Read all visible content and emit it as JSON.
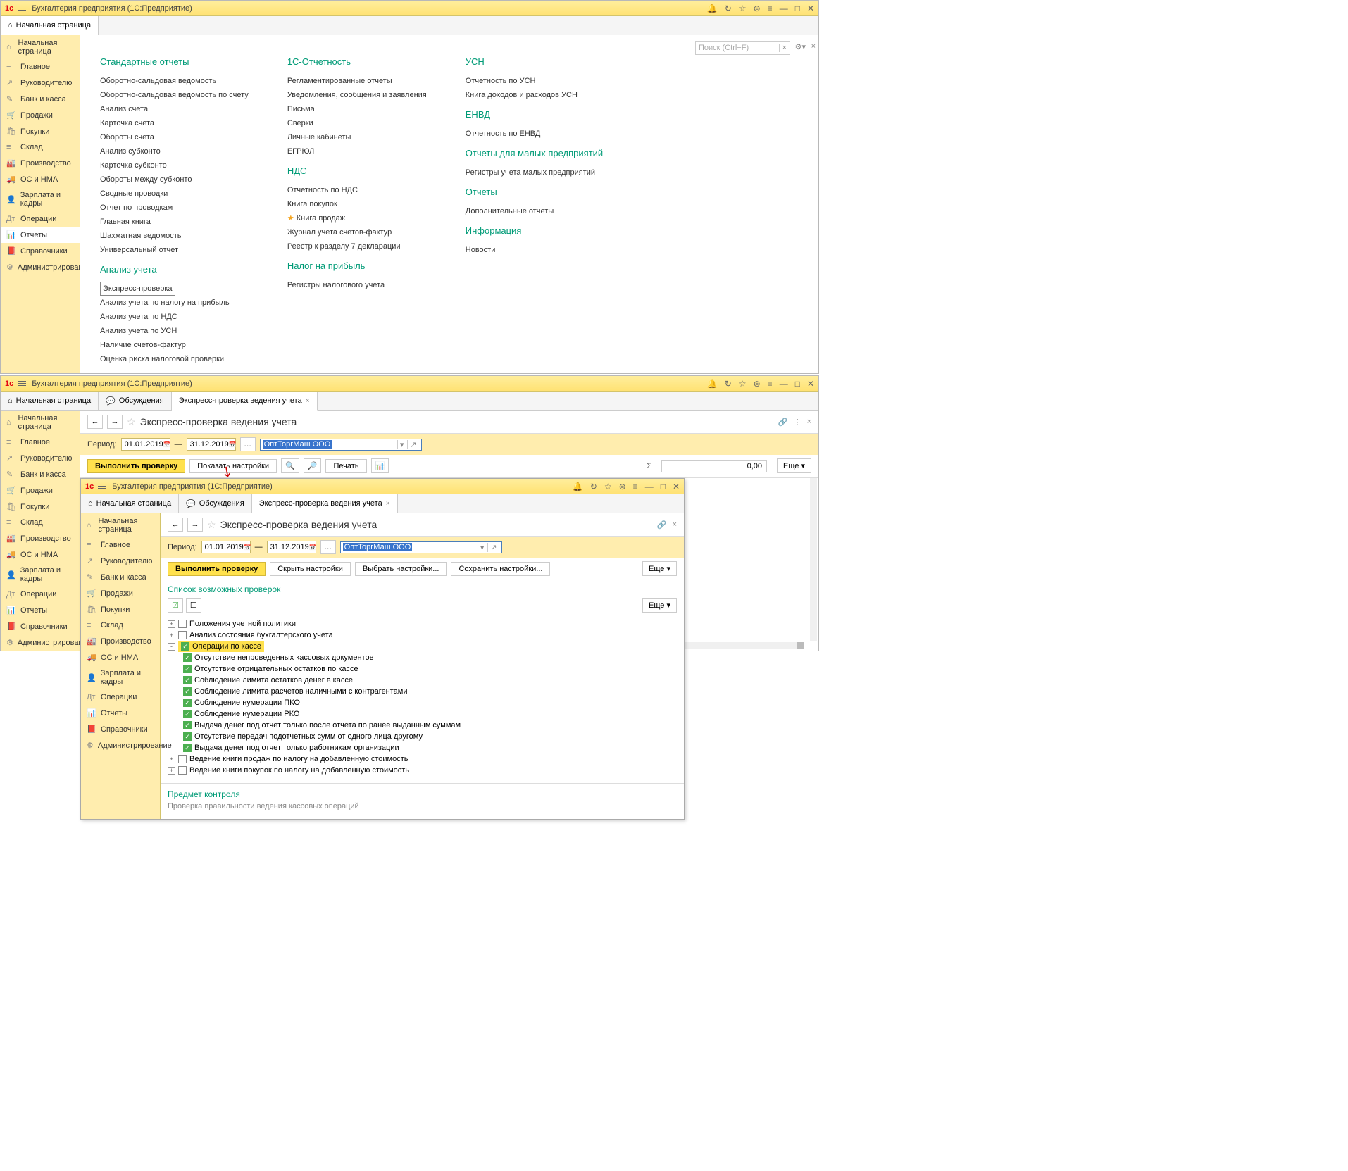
{
  "titlebar": {
    "app": "Бухгалтерия предприятия",
    "platform": "(1С:Предприятие)"
  },
  "search_placeholder": "Поиск (Ctrl+F)",
  "sidebar": [
    {
      "icon": "⌂",
      "label": "Начальная страница"
    },
    {
      "icon": "≡",
      "label": "Главное"
    },
    {
      "icon": "↗",
      "label": "Руководителю"
    },
    {
      "icon": "✎",
      "label": "Банк и касса"
    },
    {
      "icon": "🛒",
      "label": "Продажи"
    },
    {
      "icon": "🛍",
      "label": "Покупки"
    },
    {
      "icon": "≡",
      "label": "Склад"
    },
    {
      "icon": "🏭",
      "label": "Производство"
    },
    {
      "icon": "🚚",
      "label": "ОС и НМА"
    },
    {
      "icon": "👤",
      "label": "Зарплата и кадры"
    },
    {
      "icon": "Дт",
      "label": "Операции"
    },
    {
      "icon": "📊",
      "label": "Отчеты"
    },
    {
      "icon": "📕",
      "label": "Справочники"
    },
    {
      "icon": "⚙",
      "label": "Администрирование"
    }
  ],
  "reports": {
    "col1": {
      "h1": "Стандартные отчеты",
      "links1": [
        "Оборотно-сальдовая ведомость",
        "Оборотно-сальдовая ведомость по счету",
        "Анализ счета",
        "Карточка счета",
        "Обороты счета",
        "Анализ субконто",
        "Карточка субконто",
        "Обороты между субконто",
        "Сводные проводки",
        "Отчет по проводкам",
        "Главная книга",
        "Шахматная ведомость",
        "Универсальный отчет"
      ],
      "h2": "Анализ учета",
      "links2_boxed": "Экспресс-проверка",
      "links2": [
        "Анализ учета по налогу на прибыль",
        "Анализ учета по НДС",
        "Анализ учета по УСН",
        "Наличие счетов-фактур",
        "Оценка риска налоговой проверки"
      ]
    },
    "col2": {
      "h1": "1С-Отчетность",
      "links1": [
        "Регламентированные отчеты",
        "Уведомления, сообщения и заявления",
        "Письма",
        "Сверки",
        "Личные кабинеты",
        "ЕГРЮЛ"
      ],
      "h2": "НДС",
      "links2": [
        "Отчетность по НДС",
        "Книга покупок"
      ],
      "links2_star": "Книга продаж",
      "links2b": [
        "Журнал учета счетов-фактур",
        "Реестр к разделу 7 декларации"
      ],
      "h3": "Налог на прибыль",
      "links3": [
        "Регистры налогового учета"
      ]
    },
    "col3": {
      "h1": "УСН",
      "links1": [
        "Отчетность по УСН",
        "Книга доходов и расходов УСН"
      ],
      "h2": "ЕНВД",
      "links2": [
        "Отчетность по ЕНВД"
      ],
      "h3": "Отчеты для малых предприятий",
      "links3": [
        "Регистры учета малых предприятий"
      ],
      "h4": "Отчеты",
      "links4": [
        "Дополнительные отчеты"
      ],
      "h5": "Информация",
      "links5": [
        "Новости"
      ]
    }
  },
  "tabs2": [
    "Начальная страница",
    "Обсуждения",
    "Экспресс-проверка ведения учета"
  ],
  "form": {
    "title": "Экспресс-проверка ведения учета",
    "period_label": "Период:",
    "date_from": "01.01.2019",
    "dash": "—",
    "date_to": "31.12.2019",
    "org": "ОптТоргМаш ООО",
    "run": "Выполнить проверку",
    "show_settings": "Показать настройки",
    "hide_settings": "Скрыть настройки",
    "choose_settings": "Выбрать настройки...",
    "save_settings": "Сохранить настройки...",
    "print": "Печать",
    "sum": "0,00",
    "more": "Еще ▾"
  },
  "checks": {
    "header": "Список возможных проверок",
    "items": [
      {
        "lvl": 0,
        "exp": "+",
        "chk": false,
        "label": "Положения учетной политики"
      },
      {
        "lvl": 0,
        "exp": "+",
        "chk": false,
        "label": "Анализ состояния бухгалтерского учета"
      },
      {
        "lvl": 0,
        "exp": "-",
        "chk": true,
        "label": "Операции по кассе",
        "hl": true
      },
      {
        "lvl": 1,
        "chk": true,
        "label": "Отсутствие непроведенных кассовых документов"
      },
      {
        "lvl": 1,
        "chk": true,
        "label": "Отсутствие отрицательных остатков по кассе"
      },
      {
        "lvl": 1,
        "chk": true,
        "label": "Соблюдение лимита остатков денег в кассе"
      },
      {
        "lvl": 1,
        "chk": true,
        "label": "Соблюдение лимита расчетов наличными с контрагентами"
      },
      {
        "lvl": 1,
        "chk": true,
        "label": "Соблюдение нумерации ПКО"
      },
      {
        "lvl": 1,
        "chk": true,
        "label": "Соблюдение нумерации РКО"
      },
      {
        "lvl": 1,
        "chk": true,
        "label": "Выдача денег под отчет только после отчета по ранее выданным суммам"
      },
      {
        "lvl": 1,
        "chk": true,
        "label": "Отсутствие передач подотчетных сумм от одного лица другому"
      },
      {
        "lvl": 1,
        "chk": true,
        "label": "Выдача денег под отчет только работникам организации"
      },
      {
        "lvl": 0,
        "exp": "+",
        "chk": false,
        "label": "Ведение книги продаж по налогу на добавленную стоимость"
      },
      {
        "lvl": 0,
        "exp": "+",
        "chk": false,
        "label": "Ведение книги покупок по налогу на добавленную стоимость"
      }
    ],
    "subject_h": "Предмет контроля",
    "subject_t": "Проверка правильности ведения кассовых операций"
  }
}
